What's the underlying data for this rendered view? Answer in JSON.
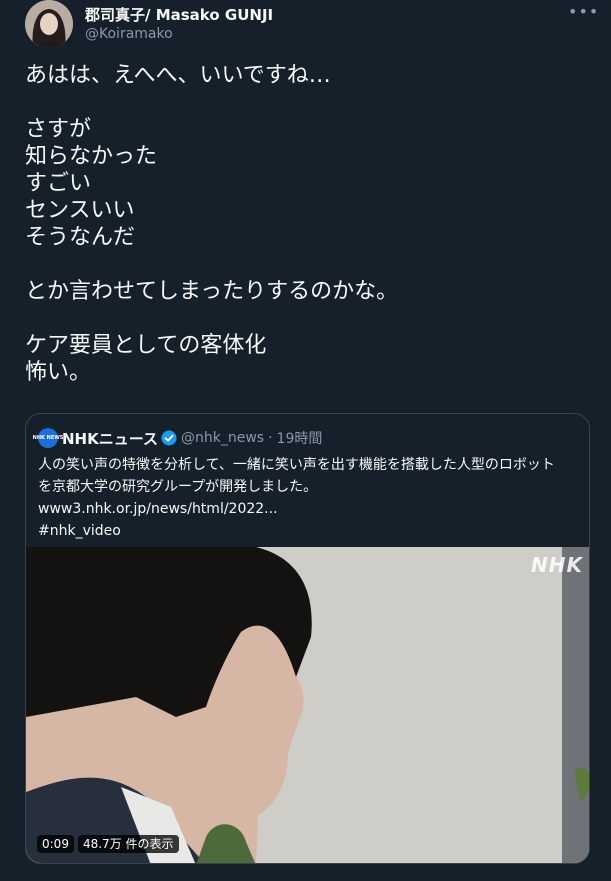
{
  "author": {
    "name": "郡司真子/ Masako GUNJI",
    "handle": "@Koiramako"
  },
  "more_icon": "more-dots-icon",
  "tweet": {
    "text": "あはは、えへへ、いいですね…\n\nさすが\n知らなかった\nすごい\nセンスいい\nそうなんだ\n\nとか言わせてしまったりするのかな。\n\nケア要員としての客体化\n怖い。"
  },
  "quote": {
    "avatar_label": "NHK NEWS",
    "name": "NHKニュース",
    "handle": "@nhk_news",
    "separator": "·",
    "time": "19時間",
    "lines": [
      "人の笑い声の特徴を分析して、一緒に笑い声を出す機能を搭載した人型のロボット",
      "を京都大学の研究グループが開発しました。",
      "www3.nhk.or.jp/news/html/2022...",
      "#nhk_video"
    ],
    "video": {
      "watermark": "NHK",
      "duration": "0:09",
      "views": "48.7万 件の表示"
    }
  },
  "colors": {
    "background": "#15202b",
    "text": "#f7f9f9",
    "secondary": "#8b98a5",
    "border": "#38444d",
    "verified": "#1d9bf0"
  }
}
